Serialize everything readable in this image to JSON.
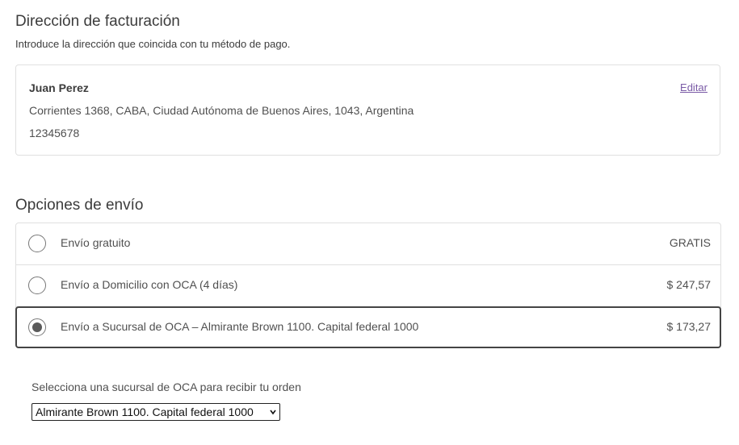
{
  "billing": {
    "title": "Dirección de facturación",
    "description": "Introduce la dirección que coincida con tu método de pago.",
    "name": "Juan Perez",
    "street": "Corrientes 1368, CABA, Ciudad Autónoma de Buenos Aires, 1043, Argentina",
    "phone": "12345678",
    "edit_label": "Editar"
  },
  "shipping": {
    "title": "Opciones de envío",
    "options": [
      {
        "label": "Envío gratuito",
        "price": "GRATIS",
        "selected": false
      },
      {
        "label": "Envío a Domicilio con OCA (4 días)",
        "price": "$ 247,57",
        "selected": false
      },
      {
        "label": "Envío a Sucursal de OCA – Almirante Brown 1100. Capital federal 1000",
        "price": "$ 173,27",
        "selected": true
      }
    ]
  },
  "branch": {
    "label": "Selecciona una sucursal de OCA para recibir tu orden",
    "selected_value": "Almirante Brown 1100. Capital federal 1000"
  },
  "colors": {
    "link": "#7a5aa6",
    "selected_border": "#444444",
    "border": "#e0e0e0"
  }
}
